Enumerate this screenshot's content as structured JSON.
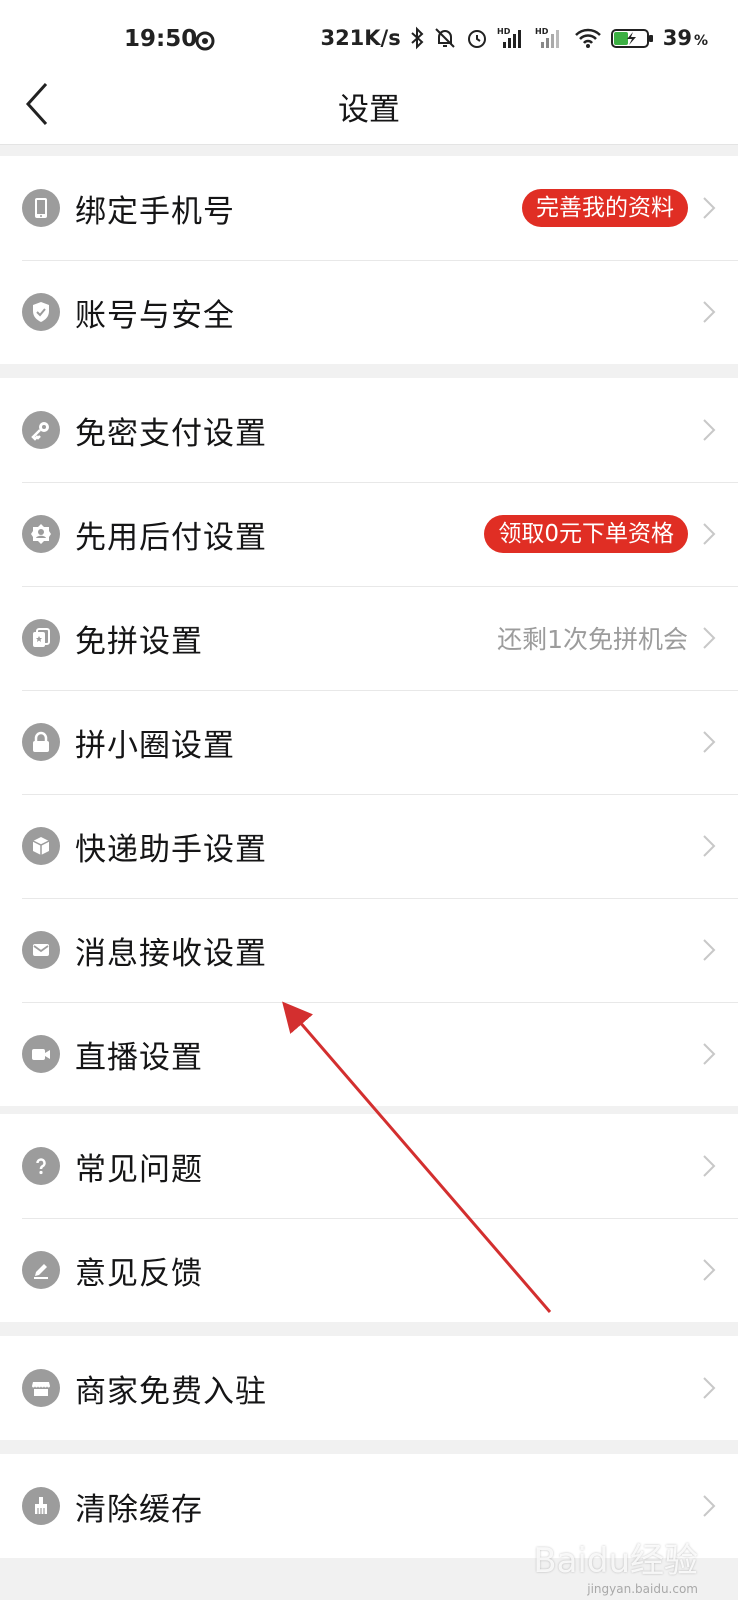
{
  "status_bar": {
    "time": "19:50",
    "network_speed": "321K/s",
    "battery": "39",
    "battery_unit": "%",
    "icons": [
      "activity-ring-icon",
      "bluetooth-icon",
      "bell-off-icon",
      "alarm-icon",
      "signal-hd-icon",
      "signal-hd-icon",
      "wifi-icon",
      "battery-charging-icon"
    ]
  },
  "header": {
    "title": "设置",
    "back_icon": "chevron-left-icon"
  },
  "groups": [
    {
      "items": [
        {
          "icon": "phone-icon",
          "label": "绑定手机号",
          "badge": "完善我的资料"
        },
        {
          "icon": "shield-check-icon",
          "label": "账号与安全"
        }
      ]
    },
    {
      "items": [
        {
          "icon": "key-icon",
          "label": "免密支付设置"
        },
        {
          "icon": "badge-gear-icon",
          "label": "先用后付设置",
          "badge": "领取0元下单资格"
        },
        {
          "icon": "cards-icon",
          "label": "免拼设置",
          "hint": "还剩1次免拼机会"
        },
        {
          "icon": "lock-icon",
          "label": "拼小圈设置"
        },
        {
          "icon": "package-icon",
          "label": "快递助手设置"
        },
        {
          "icon": "mail-icon",
          "label": "消息接收设置"
        },
        {
          "icon": "video-icon",
          "label": "直播设置"
        }
      ]
    },
    {
      "items": [
        {
          "icon": "question-icon",
          "label": "常见问题"
        },
        {
          "icon": "pencil-icon",
          "label": "意见反馈"
        }
      ]
    },
    {
      "items": [
        {
          "icon": "store-icon",
          "label": "商家免费入驻"
        }
      ]
    },
    {
      "items": [
        {
          "icon": "broom-icon",
          "label": "清除缓存"
        }
      ]
    }
  ],
  "annotation_color": "#d32f2f",
  "colors": {
    "badge_bg": "#e02e24",
    "icon_bg": "#9c9c9c",
    "hint_text": "#9c9c9c",
    "page_bg": "#f1f1f1"
  },
  "watermark": {
    "text": "Baidu经验",
    "sub": "jingyan.baidu.com"
  }
}
